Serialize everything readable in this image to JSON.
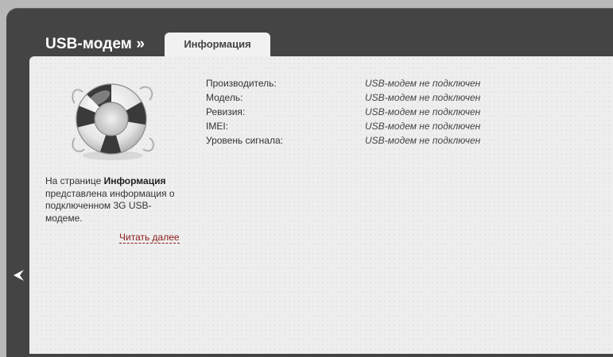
{
  "header": {
    "title": "USB-модем »",
    "tabs": [
      {
        "label": "Информация",
        "active": true
      }
    ]
  },
  "sidebar": {
    "desc_prefix": "На странице ",
    "desc_bold": "Информация",
    "desc_suffix": " представлена информация о подключенном 3G USB-модеме.",
    "read_more": "Читать далее",
    "icon": "lifebuoy-icon"
  },
  "info": {
    "rows": [
      {
        "label": "Производитель:",
        "value": "USB-модем не подключен"
      },
      {
        "label": "Модель:",
        "value": "USB-модем не подключен"
      },
      {
        "label": "Ревизия:",
        "value": "USB-модем не подключен"
      },
      {
        "label": "IMEI:",
        "value": "USB-модем не подключен"
      },
      {
        "label": "Уровень сигнала:",
        "value": "USB-модем не подключен"
      }
    ]
  },
  "nav": {
    "back_icon": "chevron-left-icon"
  },
  "colors": {
    "frame": "#444444",
    "content_bg": "#eeeeee",
    "link": "#8b1a1a",
    "tab_bg": "#f1f1f1"
  }
}
